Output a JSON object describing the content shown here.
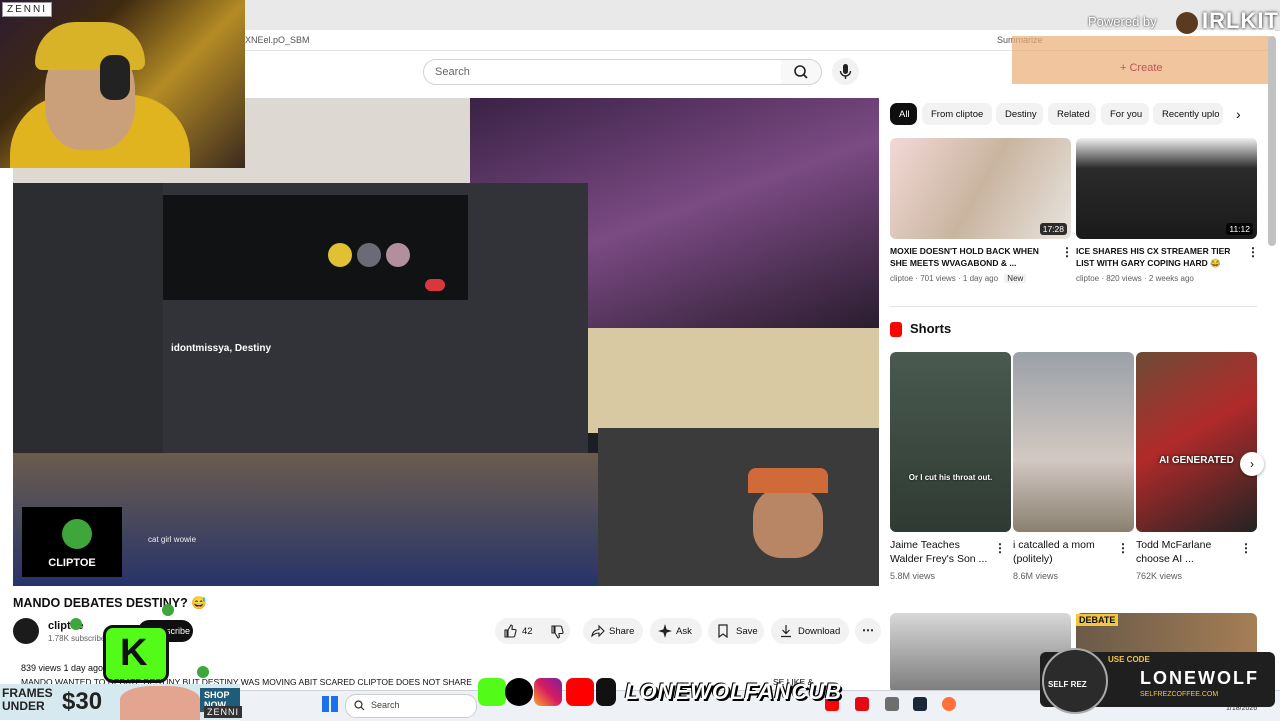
{
  "browser": {
    "url_fragment": "XNEel.pO_SBM",
    "summary_label": "Summarize"
  },
  "search": {
    "placeholder": "Search"
  },
  "overlay": {
    "zenni_top": "ZENNI",
    "powered_by": "Powered by",
    "irlkit": "IRLKIT",
    "create": "+ Create"
  },
  "video": {
    "discord_name": "idontmissya, Destiny",
    "chat_line": "cat girl wowie",
    "cliptoe_logo": "CLIPTOE"
  },
  "title_area": {
    "title": "MANDO DEBATES DESTINY?",
    "title_emoji": "😅",
    "channel": "cliptoe",
    "subs": "1.78K subscribers",
    "subscribe": "Subscribe",
    "likes": "42",
    "share": "Share",
    "ask": "Ask",
    "save": "Save",
    "download": "Download",
    "views_time": "839 views  1 day ago",
    "description": "MANDO WANTED TO DEBATE DESTINY BUT DESTINY WAS MOVING ABIT SCARED CLIPTOE DOES NOT SHARE",
    "description_end": "SE LIKE &"
  },
  "chips": [
    "All",
    "From cliptoe",
    "Destiny",
    "Related",
    "For you",
    "Recently uplo"
  ],
  "sidebar_videos": [
    {
      "title_l1": "MOXIE DOESN'T HOLD BACK WHEN",
      "title_l2": "SHE MEETS WVAGABOND & ...",
      "meta": "cliptoe · 701 views · 1 day ago",
      "badge": "New",
      "duration": "17:28"
    },
    {
      "title_l1": "ICE SHARES HIS CX STREAMER TIER",
      "title_l2": "LIST WITH GARY COPING HARD 😂",
      "meta": "cliptoe · 820 views · 2 weeks ago",
      "badge": "",
      "duration": "11:12"
    }
  ],
  "shorts": {
    "heading": "Shorts",
    "items": [
      {
        "title_l1": "Jaime Teaches",
        "title_l2": "Walder Frey's Son ...",
        "views": "5.8M views",
        "caption": "Or I cut his throat out."
      },
      {
        "title_l1": "i catcalled a mom",
        "title_l2": "(politely)",
        "views": "8.6M views",
        "caption": ""
      },
      {
        "title_l1": "Todd McFarlane",
        "title_l2": "choose AI ...",
        "views": "762K views",
        "caption": "AI GENERATED"
      }
    ]
  },
  "bottom_overlay": {
    "frames_under": "FRAMES\nUNDER",
    "frames_price": "$30",
    "shop_now": "SHOP NOW",
    "zenni": "ZENNI",
    "handle": "LONEWOLFANCUB",
    "debate": "DEBATE",
    "selfrez_use_code": "USE CODE",
    "selfrez_badge": "SELF REZ",
    "lonewolf": "LONEWOLF",
    "selfrez_url": "SELFREZCOFFEE.COM"
  },
  "taskbar": {
    "search": "Search",
    "date": "1/18/2026"
  },
  "colors": {
    "kick_green": "#53fc18",
    "youtube_red": "#ff0000",
    "accent_dark": "#0f0f0f"
  }
}
